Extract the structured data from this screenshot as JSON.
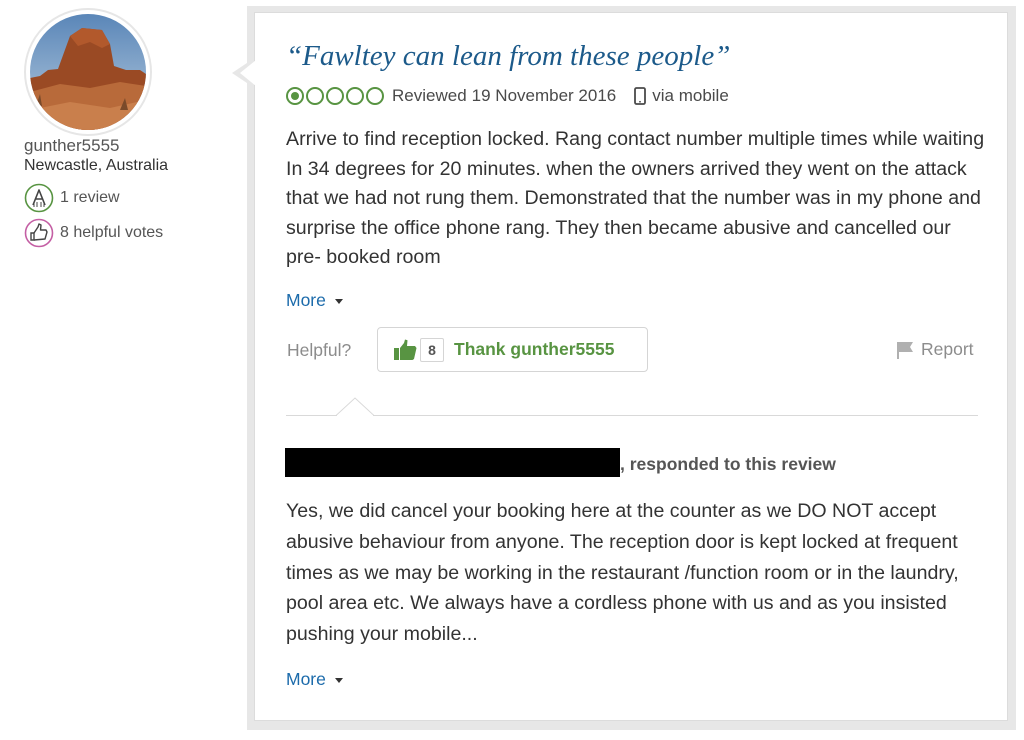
{
  "member": {
    "username": "gunther5555",
    "location": "Newcastle, Australia",
    "reviews_badge": {
      "icon": "reviewer-badge-icon",
      "label": "1 review"
    },
    "votes_badge": {
      "icon": "helpful-votes-icon",
      "label": "8 helpful votes"
    }
  },
  "review": {
    "title": "“Fawltey can lean from these people”",
    "rating": {
      "value": 1,
      "max": 5,
      "color": "#589442"
    },
    "reviewed_label": "Reviewed",
    "date": "19 November 2016",
    "device_icon": "mobile-phone-icon",
    "via": "via mobile",
    "text": "Arrive to find reception locked. Rang contact number multiple times while waiting In 34 degrees for 20 minutes. when the owners arrived they went on the attack that we had not rung them. Demonstrated that the number was in my phone and surprise the office phone rang. They then became abusive and cancelled our pre- booked room",
    "more_label": "More"
  },
  "actions": {
    "helpful_label": "Helpful?",
    "thank_count": "8",
    "thank_label": "Thank gunther5555",
    "report_label": "Report"
  },
  "response": {
    "responded_label": ", responded to this review",
    "text": "Yes, we did cancel your booking here at the counter as we DO NOT accept abusive behaviour from anyone. The reception door is kept locked at frequent times as we may be working in the restaurant /function room or in the laundry, pool area etc. We always have a cordless phone with us and as you insisted pushing your mobile...",
    "more_label": "More"
  },
  "colors": {
    "title": "#1c5a8a",
    "link": "#1c6bab",
    "bubble_green": "#589442",
    "badge_green": "#589442",
    "badge_purple": "#c45fa4"
  }
}
